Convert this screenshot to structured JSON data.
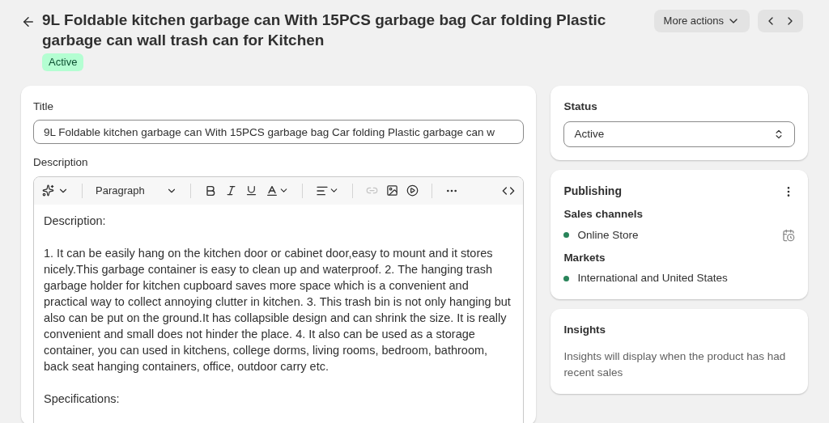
{
  "header": {
    "title": "9L Foldable kitchen garbage can With 15PCS garbage bag Car folding Plastic garbage can wall trash can for Kitchen",
    "status_badge": "Active",
    "more_actions": "More actions"
  },
  "product": {
    "title_label": "Title",
    "title_value": "9L Foldable kitchen garbage can With 15PCS garbage bag Car folding Plastic garbage can w",
    "description_label": "Description",
    "toolbar": {
      "format": "Paragraph",
      "link_disabled": true
    },
    "description_paragraphs": [
      "Description:",
      "1. It can be easily hang on the kitchen door or cabinet door,easy to mount and it stores nicely.This garbage container is easy to clean up and waterproof. 2. The hanging trash garbage holder for kitchen cupboard saves more space which is a convenient and practical way to collect annoying clutter in kitchen. 3. This trash bin is not only hanging but also can be put on the ground.It has collapsible design and can shrink the size. It is really convenient and small does not hinder the place. 4. It also can be used as a storage container, you can used in kitchens, college dorms, living rooms, bedroom, bathroom, back seat hanging containers, office, outdoor carry etc.",
      "Specifications:"
    ]
  },
  "status": {
    "label": "Status",
    "value": "Active"
  },
  "publishing": {
    "title": "Publishing",
    "groups": [
      {
        "label": "Sales channels",
        "items": [
          {
            "name": "Online Store",
            "color": "#29845a",
            "schedule_icon": true
          }
        ]
      },
      {
        "label": "Markets",
        "items": [
          {
            "name": "International and United States",
            "color": "#29845a",
            "schedule_icon": false
          }
        ]
      }
    ]
  },
  "insights": {
    "title": "Insights",
    "text": "Insights will display when the product has had recent sales"
  }
}
